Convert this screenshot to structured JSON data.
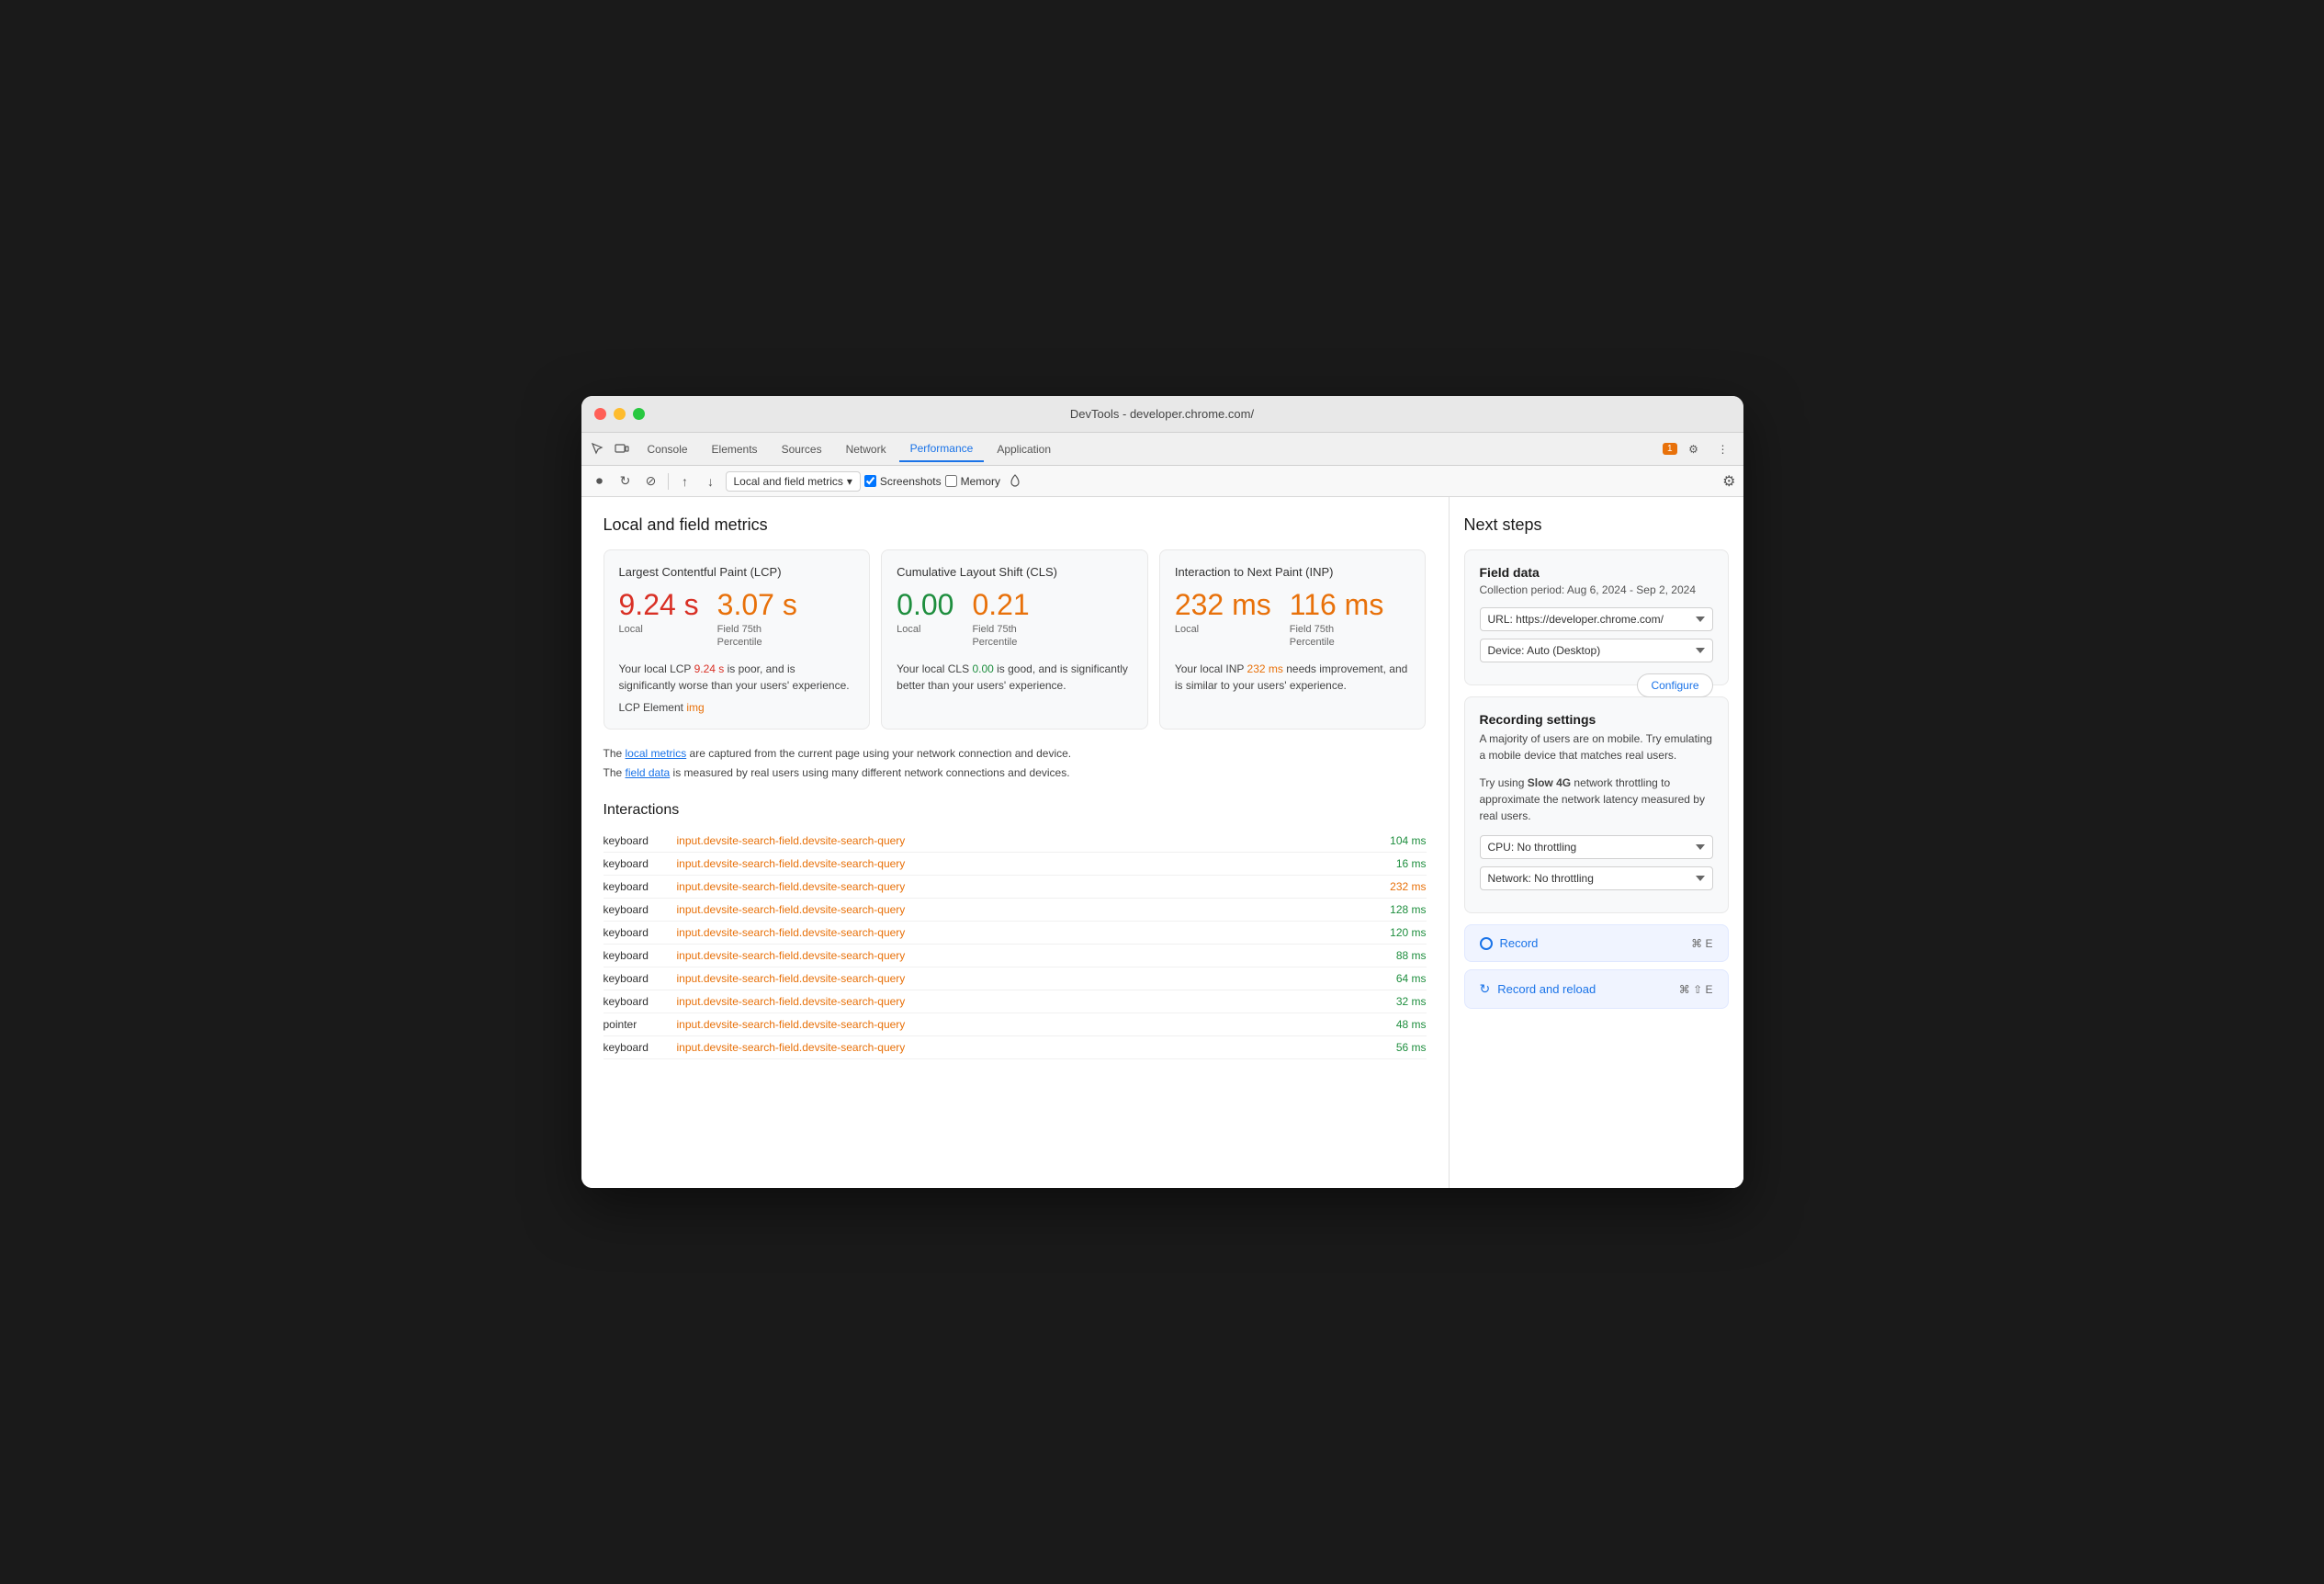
{
  "window": {
    "title": "DevTools - developer.chrome.com/"
  },
  "tabs": [
    {
      "id": "console",
      "label": "Console",
      "active": false
    },
    {
      "id": "elements",
      "label": "Elements",
      "active": false
    },
    {
      "id": "sources",
      "label": "Sources",
      "active": false
    },
    {
      "id": "network",
      "label": "Network",
      "active": false
    },
    {
      "id": "performance",
      "label": "Performance",
      "active": true
    },
    {
      "id": "application",
      "label": "Application",
      "active": false
    }
  ],
  "toolbar": {
    "dropdown_label": "Local and field metrics",
    "screenshots_label": "Screenshots",
    "memory_label": "Memory"
  },
  "main": {
    "section_title": "Local and field metrics",
    "metrics": [
      {
        "id": "lcp",
        "title": "Largest Contentful Paint (LCP)",
        "local_value": "9.24 s",
        "local_color": "red",
        "field_value": "3.07 s",
        "field_color": "orange",
        "field_label": "Field 75th\nPercentile",
        "local_label": "Local",
        "description": "Your local LCP 9.24 s is poor, and is significantly worse than your users' experience.",
        "desc_highlight": "9.24 s",
        "desc_highlight_color": "red",
        "element_label": "LCP Element",
        "element_value": "img",
        "element_color": "orange"
      },
      {
        "id": "cls",
        "title": "Cumulative Layout Shift (CLS)",
        "local_value": "0.00",
        "local_color": "green",
        "field_value": "0.21",
        "field_color": "orange",
        "field_label": "Field 75th\nPercentile",
        "local_label": "Local",
        "description": "Your local CLS 0.00 is good, and is significantly better than your users' experience.",
        "desc_highlight": "0.00",
        "desc_highlight_color": "green"
      },
      {
        "id": "inp",
        "title": "Interaction to Next Paint (INP)",
        "local_value": "232 ms",
        "local_color": "orange",
        "field_value": "116 ms",
        "field_color": "orange",
        "field_label": "Field 75th\nPercentile",
        "local_label": "Local",
        "description": "Your local INP 232 ms needs improvement, and is similar to your users' experience.",
        "desc_highlight": "232 ms",
        "desc_highlight_color": "orange"
      }
    ],
    "info_line1": "The local metrics are captured from the current page using your network connection and device.",
    "info_line2": "The field data is measured by real users using many different network connections and devices.",
    "interactions_title": "Interactions",
    "interactions": [
      {
        "type": "keyboard",
        "element": "input.devsite-search-field.devsite-search-query",
        "time": "104 ms",
        "time_color": "green"
      },
      {
        "type": "keyboard",
        "element": "input.devsite-search-field.devsite-search-query",
        "time": "16 ms",
        "time_color": "green"
      },
      {
        "type": "keyboard",
        "element": "input.devsite-search-field.devsite-search-query",
        "time": "232 ms",
        "time_color": "orange"
      },
      {
        "type": "keyboard",
        "element": "input.devsite-search-field.devsite-search-query",
        "time": "128 ms",
        "time_color": "green"
      },
      {
        "type": "keyboard",
        "element": "input.devsite-search-field.devsite-search-query",
        "time": "120 ms",
        "time_color": "green"
      },
      {
        "type": "keyboard",
        "element": "input.devsite-search-field.devsite-search-query",
        "time": "88 ms",
        "time_color": "green"
      },
      {
        "type": "keyboard",
        "element": "input.devsite-search-field.devsite-search-query",
        "time": "64 ms",
        "time_color": "green"
      },
      {
        "type": "keyboard",
        "element": "input.devsite-search-field.devsite-search-query",
        "time": "32 ms",
        "time_color": "green"
      },
      {
        "type": "pointer",
        "element": "input.devsite-search-field.devsite-search-query",
        "time": "48 ms",
        "time_color": "green"
      },
      {
        "type": "keyboard",
        "element": "input.devsite-search-field.devsite-search-query",
        "time": "56 ms",
        "time_color": "green"
      }
    ]
  },
  "right_panel": {
    "title": "Next steps",
    "field_data": {
      "title": "Field data",
      "subtitle": "Collection period: Aug 6, 2024 - Sep 2, 2024",
      "url_option": "URL: https://developer.chrome.com/",
      "device_option": "Device: Auto (Desktop)",
      "configure_label": "Configure"
    },
    "recording_settings": {
      "title": "Recording settings",
      "desc1": "A majority of users are on mobile. Try emulating a mobile device that matches real users.",
      "desc2": "Try using Slow 4G network throttling to approximate the network latency measured by real users.",
      "cpu_option": "CPU: No throttling",
      "network_option": "Network: No throttling"
    },
    "record": {
      "label": "Record",
      "shortcut": "⌘ E"
    },
    "record_reload": {
      "label": "Record and reload",
      "shortcut": "⌘ ⇧ E"
    }
  }
}
